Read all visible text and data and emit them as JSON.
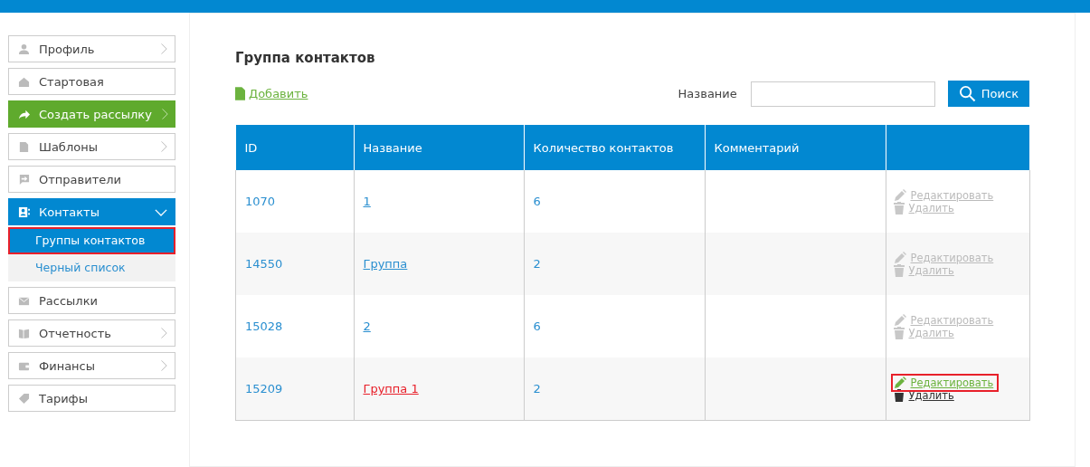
{
  "sidebar": {
    "items": [
      {
        "label": "Профиль",
        "kind": "plain",
        "chevron": true
      },
      {
        "label": "Стартовая",
        "kind": "plain",
        "chevron": false
      },
      {
        "label": "Создать рассылку",
        "kind": "accent",
        "chevron": true
      },
      {
        "label": "Шаблоны",
        "kind": "plain",
        "chevron": true
      },
      {
        "label": "Отправители",
        "kind": "plain",
        "chevron": false
      },
      {
        "label": "Контакты",
        "kind": "open",
        "chevron": true,
        "children": [
          {
            "label": "Группы контактов",
            "selected": true,
            "highlighted": true
          },
          {
            "label": "Черный список",
            "selected": false,
            "highlighted": false
          }
        ]
      },
      {
        "label": "Рассылки",
        "kind": "plain",
        "chevron": false
      },
      {
        "label": "Отчетность",
        "kind": "plain",
        "chevron": true
      },
      {
        "label": "Финансы",
        "kind": "plain",
        "chevron": true
      },
      {
        "label": "Тарифы",
        "kind": "plain",
        "chevron": false
      }
    ]
  },
  "page": {
    "title": "Группа контактов",
    "add_link": "Добавить",
    "search": {
      "label": "Название",
      "button": "Поиск"
    },
    "table": {
      "columns": [
        "ID",
        "Название",
        "Количество контактов",
        "Комментарий"
      ],
      "rows": [
        {
          "id": "1070",
          "name": "1",
          "count": "6",
          "edit": "Редактировать",
          "delete": "Удалить",
          "hovered": false,
          "highlighted": false
        },
        {
          "id": "14550",
          "name": "Группа",
          "count": "2",
          "edit": "Редактировать",
          "delete": "Удалить",
          "hovered": false,
          "highlighted": false
        },
        {
          "id": "15028",
          "name": "2",
          "count": "6",
          "edit": "Редактировать",
          "delete": "Удалить",
          "hovered": false,
          "highlighted": false
        },
        {
          "id": "15209",
          "name": "Группа 1",
          "count": "2",
          "edit": "Редактировать",
          "delete": "Удалить",
          "hovered": true,
          "highlighted": true
        }
      ]
    }
  }
}
